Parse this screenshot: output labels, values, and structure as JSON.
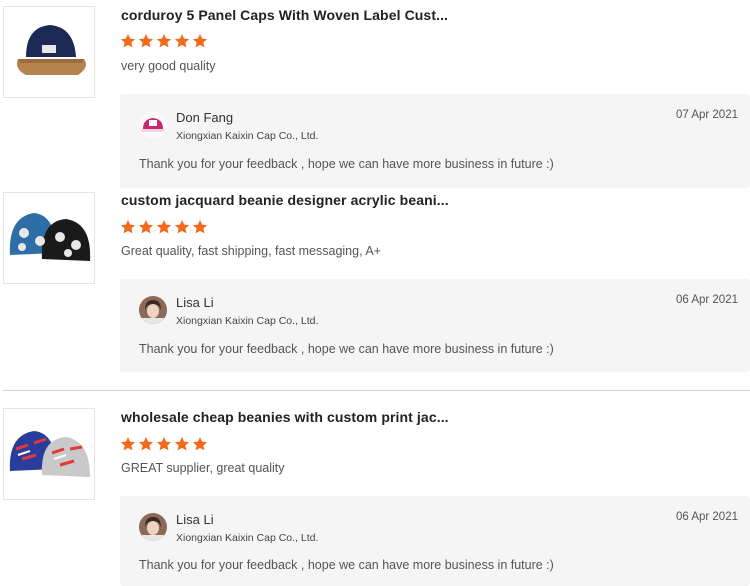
{
  "colors": {
    "star": "#f26b1d",
    "reply_bg": "#f5f5f5"
  },
  "reviews": [
    {
      "product_title": "corduroy 5 Panel Caps With Woven Label Cust...",
      "rating": 5,
      "comment": "very good quality",
      "reply": {
        "seller_name": "Don Fang",
        "company": "Xiongxian Kaixin Cap Co., Ltd.",
        "date": "07 Apr 2021",
        "text": "Thank you for your feedback , hope we can have more business in future :)"
      }
    },
    {
      "product_title": "custom jacquard beanie designer acrylic beani...",
      "rating": 5,
      "comment": "Great quality, fast shipping, fast messaging, A+",
      "reply": {
        "seller_name": "Lisa Li",
        "company": "Xiongxian Kaixin Cap Co., Ltd.",
        "date": "06 Apr 2021",
        "text": "Thank you for your feedback , hope we can have more business in future :)"
      }
    },
    {
      "product_title": "wholesale cheap beanies with custom print jac...",
      "rating": 5,
      "comment": "GREAT supplier, great quality",
      "reply": {
        "seller_name": "Lisa Li",
        "company": "Xiongxian Kaixin Cap Co., Ltd.",
        "date": "06 Apr 2021",
        "text": "Thank you for your feedback , hope we can have more business in future :)"
      }
    }
  ]
}
